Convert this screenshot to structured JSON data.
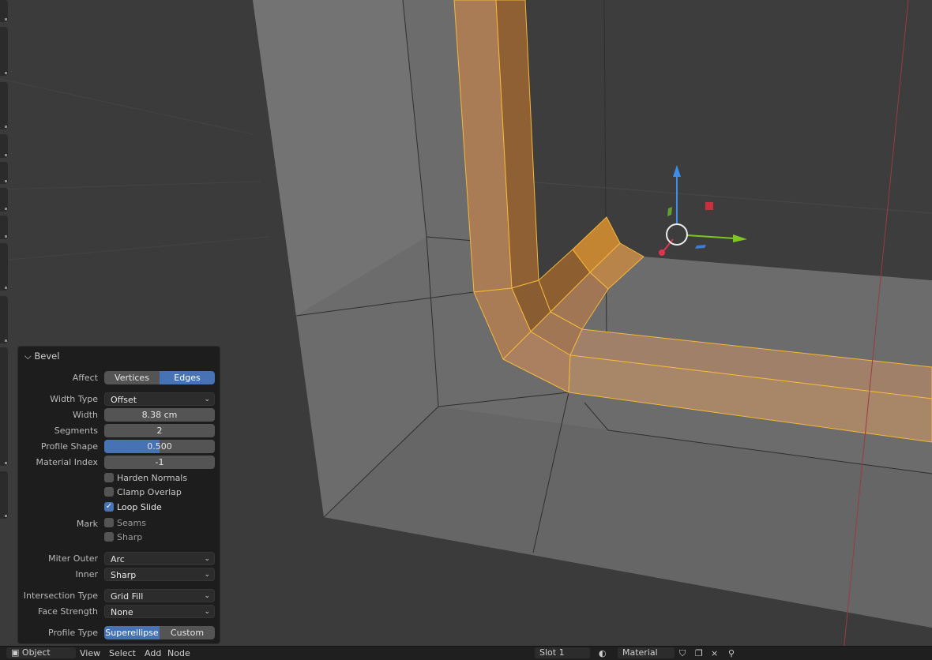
{
  "bevel_panel": {
    "title": "Bevel",
    "affect": {
      "label": "Affect",
      "options": [
        "Vertices",
        "Edges"
      ],
      "selected": "Edges"
    },
    "width_type": {
      "label": "Width Type",
      "value": "Offset"
    },
    "width": {
      "label": "Width",
      "value": "8.38 cm"
    },
    "segments": {
      "label": "Segments",
      "value": "2"
    },
    "profile_shape": {
      "label": "Profile Shape",
      "value": "0.500",
      "fraction": 0.5
    },
    "material_index": {
      "label": "Material Index",
      "value": "-1"
    },
    "harden_normals": {
      "label": "Harden Normals",
      "checked": false
    },
    "clamp_overlap": {
      "label": "Clamp Overlap",
      "checked": false
    },
    "loop_slide": {
      "label": "Loop Slide",
      "checked": true
    },
    "mark": {
      "label": "Mark",
      "seams": "Seams",
      "sharp": "Sharp"
    },
    "miter_outer": {
      "label": "Miter Outer",
      "value": "Arc"
    },
    "inner": {
      "label": "Inner",
      "value": "Sharp"
    },
    "intersection_type": {
      "label": "Intersection Type",
      "value": "Grid Fill"
    },
    "face_strength": {
      "label": "Face Strength",
      "value": "None"
    },
    "profile_type": {
      "label": "Profile Type",
      "options": [
        "Superellipse",
        "Custom"
      ],
      "selected": "Superellipse"
    }
  },
  "bottom_bar": {
    "mode": "Object",
    "menus": [
      "View",
      "Select",
      "Add",
      "Node"
    ],
    "slot": "Slot 1",
    "material": "Material"
  },
  "colors": {
    "accent": "#4772b3",
    "selection": "#f5a623",
    "axis_x": "#e0334d",
    "axis_y": "#7ec71f",
    "axis_z": "#3d8ee8"
  }
}
